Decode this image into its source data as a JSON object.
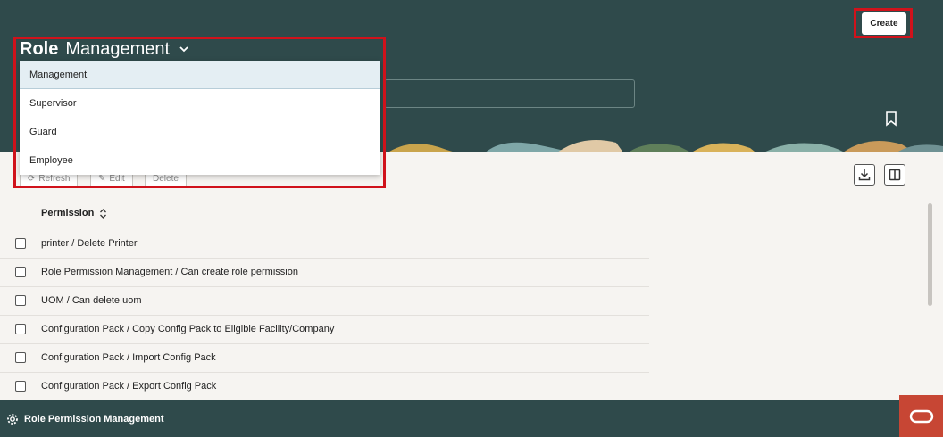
{
  "header": {
    "title_prefix": "Role",
    "title_selected": "Management",
    "create_label": "Create"
  },
  "dropdown": {
    "options": [
      "Management",
      "Supervisor",
      "Guard",
      "Employee"
    ],
    "selected": "Management"
  },
  "toolbar": {
    "refresh_label": "Refresh",
    "edit_label": "Edit",
    "delete_label": "Delete"
  },
  "table": {
    "column_header": "Permission",
    "rows": [
      "printer / Delete Printer",
      "Role Permission Management / Can create role permission",
      "UOM / Can delete uom",
      "Configuration Pack / Copy Config Pack to Eligible Facility/Company",
      "Configuration Pack / Import Config Pack",
      "Configuration Pack / Export Config Pack"
    ]
  },
  "footer": {
    "label": "Role Permission Management"
  },
  "colors": {
    "header_bg": "#2f4a4b",
    "highlight": "#d0121b",
    "oracle": "#c74634"
  }
}
